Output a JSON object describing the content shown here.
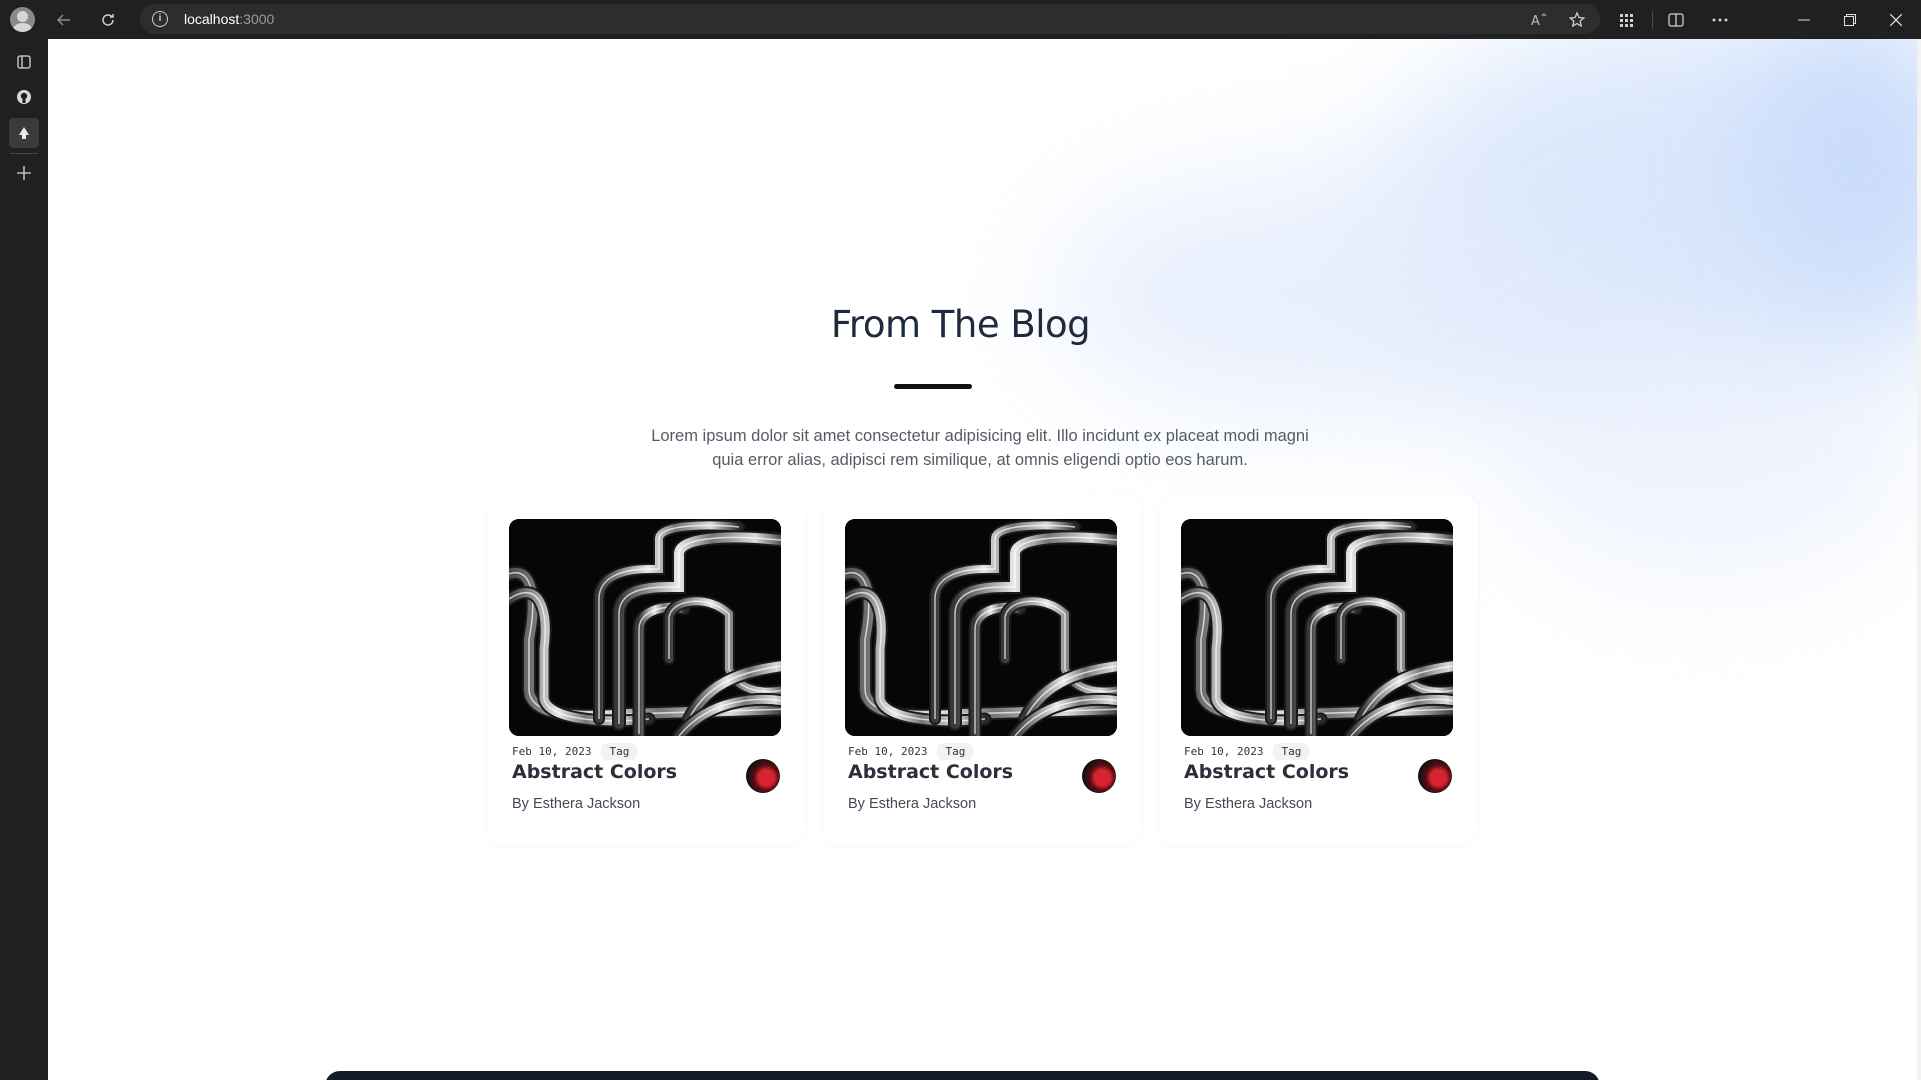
{
  "browser": {
    "url_host": "localhost",
    "url_port": ":3000"
  },
  "blog": {
    "heading": "From The Blog",
    "description": "Lorem ipsum dolor sit amet consectetur adipisicing elit. Illo incidunt ex placeat modi magni quia error alias, adipisci rem similique, at omnis eligendi optio eos harum.",
    "posts": [
      {
        "date": "Feb 10, 2023",
        "tag": "Tag",
        "title": "Abstract Colors",
        "author": "By Esthera Jackson"
      },
      {
        "date": "Feb 10, 2023",
        "tag": "Tag",
        "title": "Abstract Colors",
        "author": "By Esthera Jackson"
      },
      {
        "date": "Feb 10, 2023",
        "tag": "Tag",
        "title": "Abstract Colors",
        "author": "By Esthera Jackson"
      }
    ]
  },
  "colors": {
    "chrome": "#202020",
    "heading": "#1f2a3c",
    "glow": "#cfe0fb",
    "footer": "#141b26"
  }
}
